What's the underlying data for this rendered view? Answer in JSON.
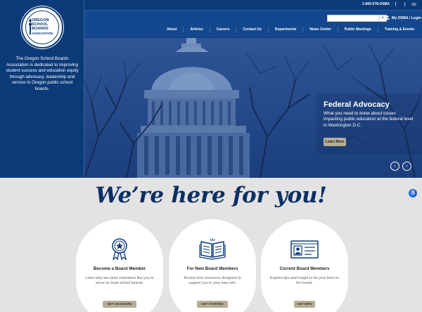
{
  "brand": {
    "logo_text": [
      "OREGON",
      "SCHOOL",
      "BOARDS",
      "ASSOCIATION"
    ],
    "mission": "The Oregon School Boards Association is dedicated to improving student success and education equity through advocacy, leadership and service to Oregon public school boards."
  },
  "utility": {
    "phone": "1-800-578-OSBA",
    "social": [
      {
        "name": "facebook-icon",
        "glyph": "f"
      },
      {
        "name": "twitter-icon",
        "glyph": "t"
      },
      {
        "name": "email-icon",
        "glyph": "✉"
      }
    ],
    "search_placeholder": "",
    "account_label": "My OSBA / Login"
  },
  "nav": {
    "items": [
      "About",
      "Articles",
      "Careers",
      "Contact Us",
      "Departments",
      "News Center",
      "Public Meetings",
      "Training & Events"
    ]
  },
  "hero": {
    "title": "Federal Advocacy",
    "text": "What you need to know about issues impacting public education at the federal level in Washington D.C.",
    "button": "Learn More",
    "prev": "‹",
    "next": "›"
  },
  "main": {
    "headline": "We’re here for you!",
    "cards": [
      {
        "title": "Become a Board Member",
        "desc": "Learn why we need volunteers like you to serve on local school boards.",
        "button": "GET ON BOARD",
        "icon": "award-ribbon-icon"
      },
      {
        "title": "For New Board Members",
        "desc": "Access free resources designed to support you in your new role.",
        "button": "GET STARTED",
        "icon": "open-book-icon"
      },
      {
        "title": "Current Board Members",
        "desc": "Explore tips and insight to be your best on the board.",
        "button": "GET INFO",
        "icon": "id-card-icon"
      }
    ]
  },
  "colors": {
    "navy": "#0b3a78",
    "nav_band": "#13488e",
    "button_tan": "#b7ad95",
    "headline": "#0b2f66",
    "background": "#e3e3e3"
  }
}
